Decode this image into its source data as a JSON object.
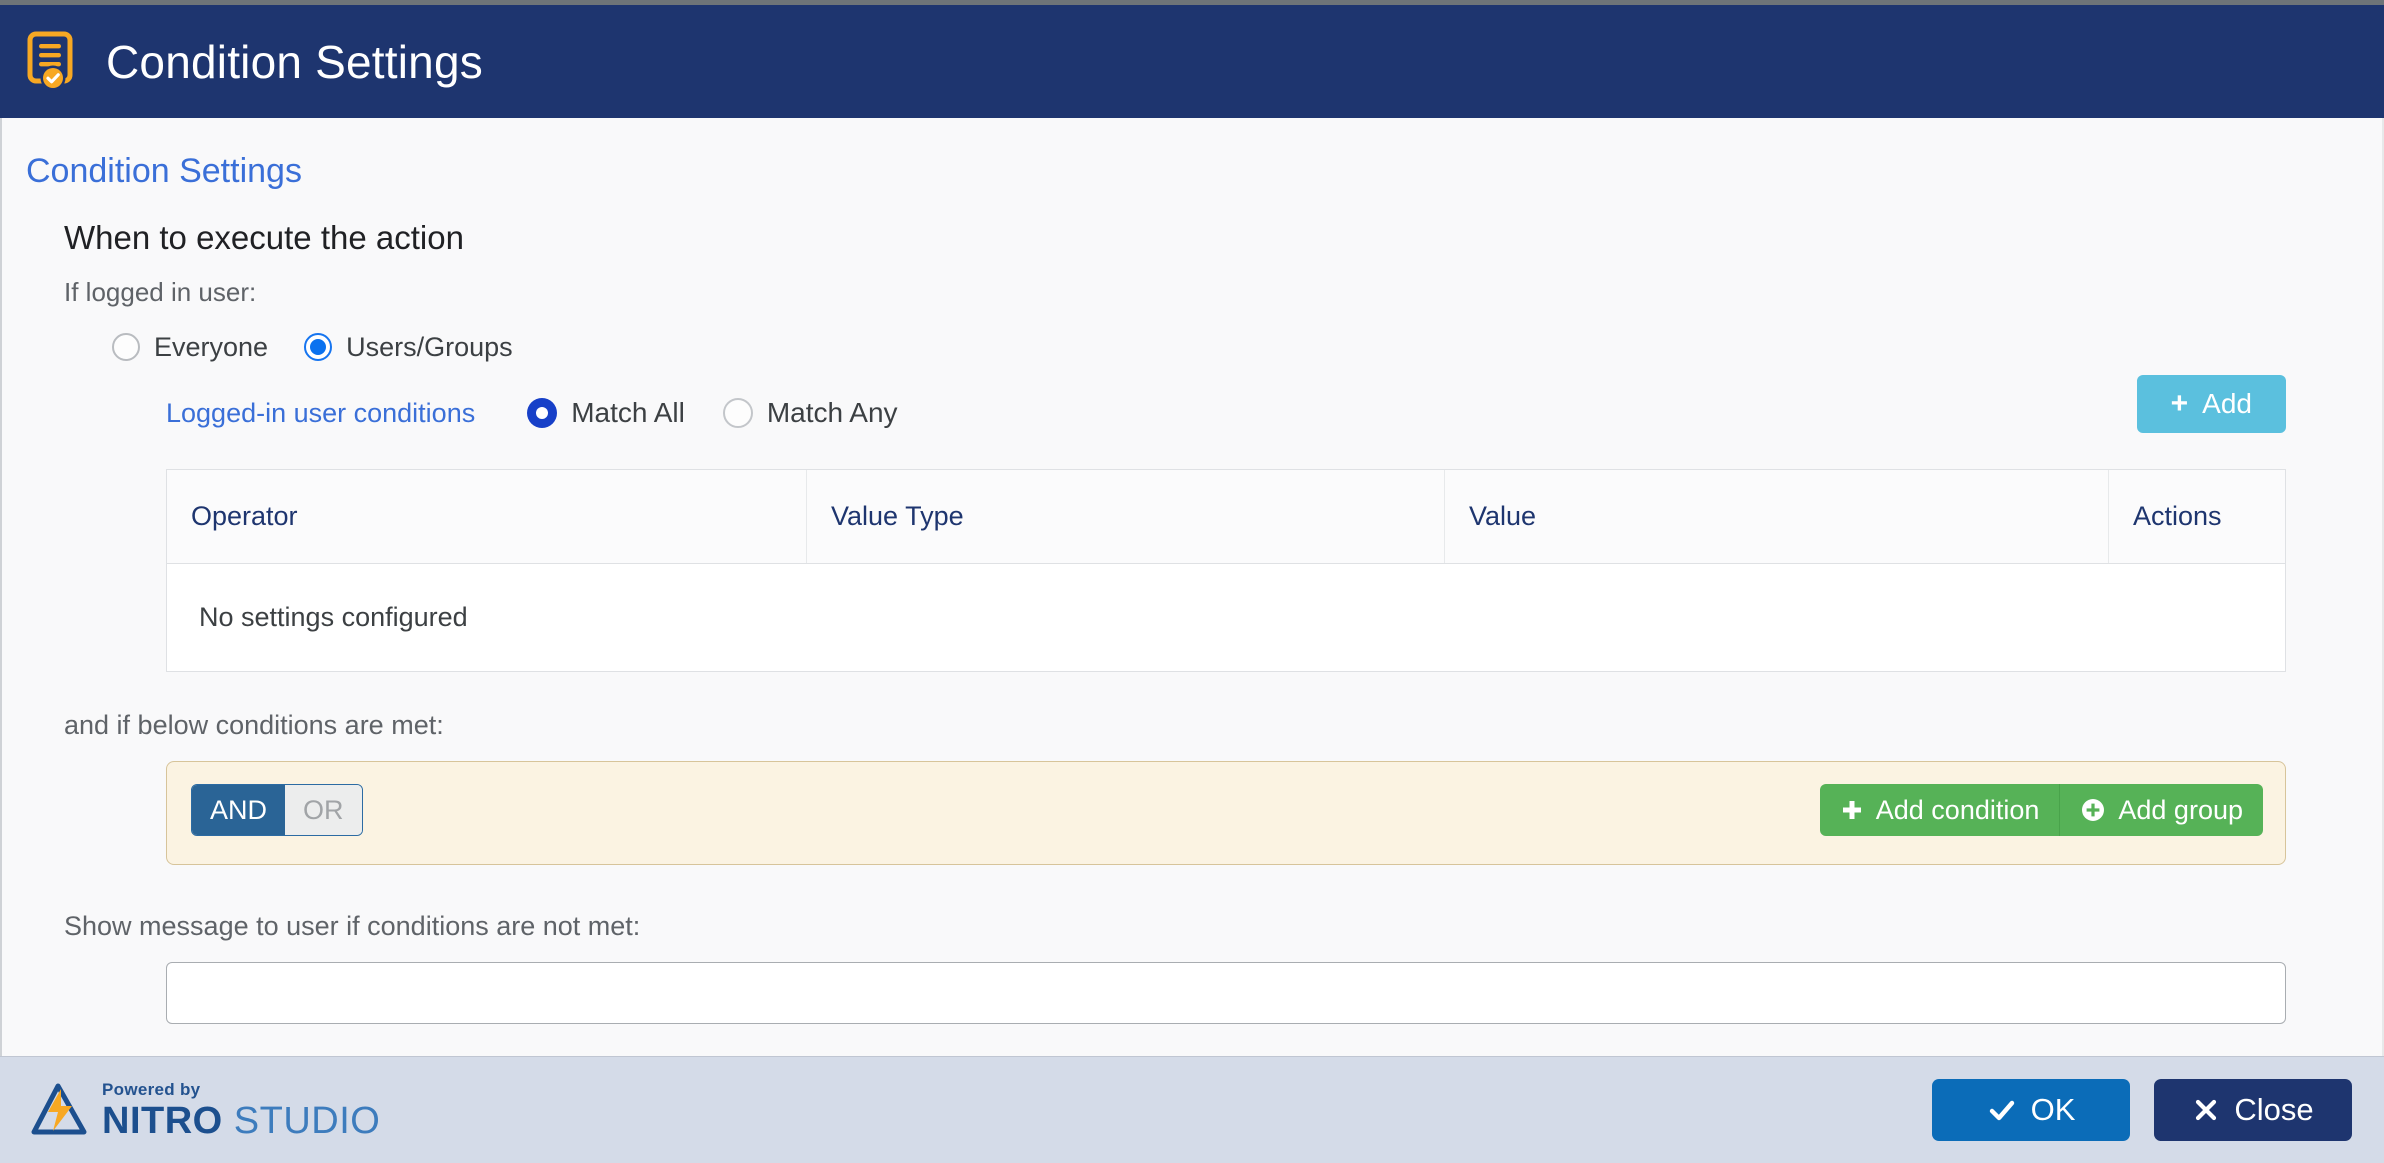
{
  "window": {
    "title": "Condition Settings",
    "icon": "document-check-icon"
  },
  "page": {
    "section_title": "Condition Settings",
    "subheading": "When to execute the action",
    "user_scope_label": "If logged in user:",
    "user_scope_options": [
      {
        "label": "Everyone",
        "selected": false
      },
      {
        "label": "Users/Groups",
        "selected": true
      }
    ],
    "conditions_link": "Logged-in user conditions",
    "match_options": [
      {
        "label": "Match All",
        "selected": true
      },
      {
        "label": "Match Any",
        "selected": false
      }
    ],
    "add_button": {
      "label": "Add",
      "icon": "plus-icon"
    },
    "table": {
      "columns": [
        "Operator",
        "Value Type",
        "Value",
        "Actions"
      ],
      "rows": [],
      "empty_message": "No settings configured"
    },
    "below_conditions_label": "and if below conditions are met:",
    "logic_toggle": [
      {
        "label": "AND",
        "active": true
      },
      {
        "label": "OR",
        "active": false
      }
    ],
    "condition_buttons": [
      {
        "label": "Add condition",
        "icon": "plus-icon"
      },
      {
        "label": "Add group",
        "icon": "plus-circle-icon"
      }
    ],
    "message_label": "Show message to user if conditions are not met:",
    "message_input": {
      "value": "",
      "placeholder": ""
    }
  },
  "footer": {
    "logo": {
      "powered_by": "Powered by",
      "brand_bold": "NITRO",
      "brand_light": " STUDIO",
      "mark": "nitro-lightning-logo"
    },
    "buttons": [
      {
        "label": "OK",
        "icon": "check-icon"
      },
      {
        "label": "Close",
        "icon": "close-x-icon"
      }
    ]
  },
  "colors": {
    "header_navy": "#1e356f",
    "accent_blue": "#3a6fd8",
    "add_button": "#5bc0de",
    "green": "#56b257",
    "panel_beige": "#fbf3e2",
    "panel_border": "#d7c49a",
    "ok_blue": "#0b6cb8",
    "footer_bg": "#d4dbe8",
    "orange": "#f7a823"
  }
}
